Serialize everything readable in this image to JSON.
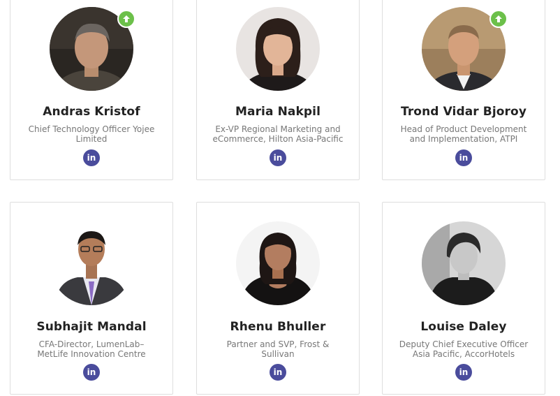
{
  "colors": {
    "card_border": "#dedede",
    "name_text": "#222222",
    "title_text": "#777777",
    "linkedin_bg": "#4a4c9c",
    "badge_bg": "#6cc04a"
  },
  "icons": {
    "linkedin": "linkedin-icon",
    "badge": "arrow-up-icon"
  },
  "speakers": [
    {
      "name": "Andras Kristof",
      "title_line1": "Chief Technology Officer Yojee",
      "title_line2": "Limited",
      "linkedin_label": "in",
      "badge": true
    },
    {
      "name": "Maria Nakpil",
      "title_line1": "Ex-VP Regional Marketing and",
      "title_line2": "eCommerce, Hilton Asia-Pacific",
      "linkedin_label": "in",
      "badge": false
    },
    {
      "name": "Trond Vidar Bjoroy",
      "title_line1": "Head of Product Development",
      "title_line2": "and Implementation, ATPI",
      "linkedin_label": "in",
      "badge": true
    },
    {
      "name": "Subhajit Mandal",
      "title_line1": "CFA-Director, LumenLab–",
      "title_line2": "MetLife Innovation Centre",
      "linkedin_label": "in",
      "badge": false
    },
    {
      "name": "Rhenu Bhuller",
      "title_line1": "Partner and SVP, Frost &",
      "title_line2": "Sullivan",
      "linkedin_label": "in",
      "badge": false
    },
    {
      "name": "Louise Daley",
      "title_line1": "Deputy Chief Executive Officer",
      "title_line2": "Asia Pacific, AccorHotels",
      "linkedin_label": "in",
      "badge": false
    }
  ]
}
